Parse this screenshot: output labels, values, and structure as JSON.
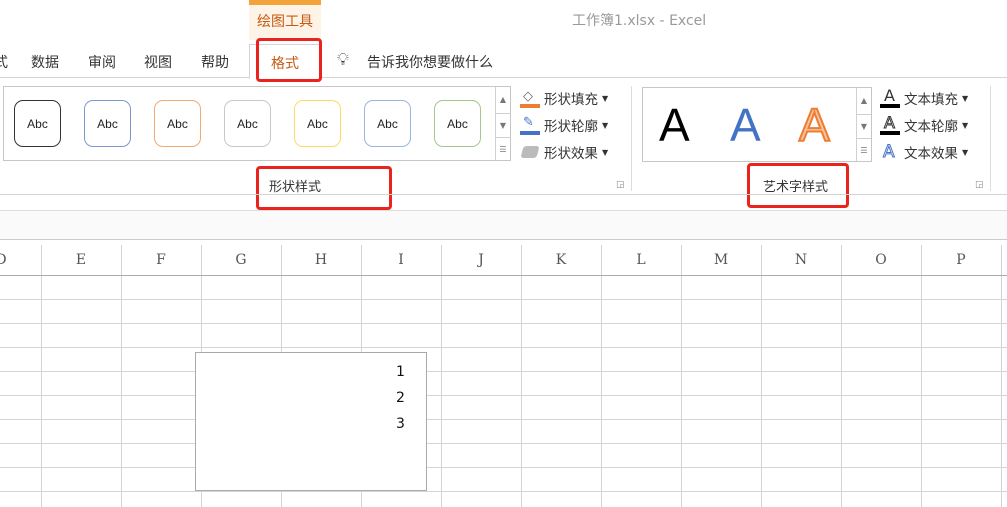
{
  "window": {
    "title": "工作簿1.xlsx  -  Excel",
    "contextual_tab_group": "绘图工具"
  },
  "tabs": [
    {
      "label": "式"
    },
    {
      "label": "数据"
    },
    {
      "label": "审阅"
    },
    {
      "label": "视图"
    },
    {
      "label": "帮助"
    },
    {
      "label": "格式",
      "active": true
    }
  ],
  "tell_me": "告诉我你想要做什么",
  "shape_styles": {
    "label": "形状样式",
    "presets": [
      {
        "text": "Abc",
        "color": "#333333"
      },
      {
        "text": "Abc",
        "color": "#4a72c4"
      },
      {
        "text": "Abc",
        "color": "#ed8a45"
      },
      {
        "text": "Abc",
        "color": "#a5a5a5"
      },
      {
        "text": "Abc",
        "color": "#ffc000"
      },
      {
        "text": "Abc",
        "color": "#6b9bd2"
      },
      {
        "text": "Abc",
        "color": "#70ad47"
      }
    ],
    "fill": "形状填充",
    "outline": "形状轮廓",
    "effects": "形状效果"
  },
  "wordart_styles": {
    "label": "艺术字样式",
    "presets": [
      {
        "text": "A",
        "color": "#000000"
      },
      {
        "text": "A",
        "color": "#4472c4"
      },
      {
        "text": "A",
        "color": "#ed7d31"
      }
    ],
    "fill": "文本填充",
    "outline": "文本轮廓",
    "effects": "文本效果"
  },
  "columns": [
    "D",
    "E",
    "F",
    "G",
    "H",
    "I",
    "J",
    "K",
    "L",
    "M",
    "N",
    "O",
    "P"
  ],
  "textbox_lines": [
    "1",
    "2",
    "3"
  ]
}
